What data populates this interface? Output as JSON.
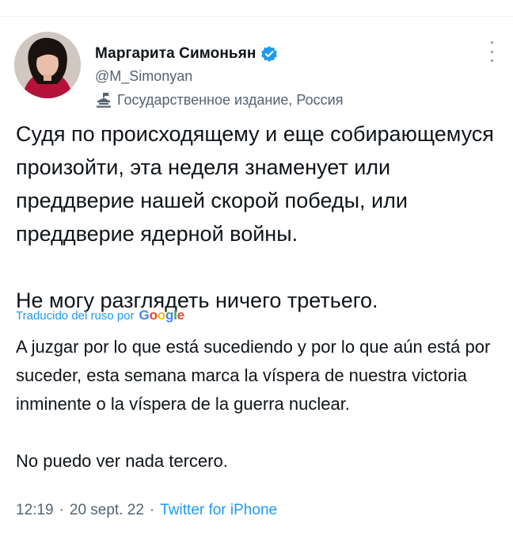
{
  "author": {
    "display_name": "Маргарита Симоньян",
    "handle": "@M_Simonyan",
    "affiliation": "Государственное издание, Россия",
    "verified_icon": "verified-badge-icon",
    "affiliation_icon": "state-media-flag-icon"
  },
  "tweet": {
    "original_paragraphs": [
      "Судя по происходящему и еще собирающемуся произойти, эта неделя знаменует или преддверие нашей скорой победы, или преддверие ядерной войны.",
      "Не могу разглядеть ничего третьего."
    ],
    "translation_label": "Traducido del ruso por",
    "translation_provider": "Google",
    "translated_paragraphs": [
      "A juzgar por lo que está sucediendo y por lo que aún está por suceder, esta semana marca la víspera de nuestra victoria inminente o la víspera de la guerra nuclear.",
      "No puedo ver nada tercero."
    ]
  },
  "meta": {
    "time": "12:19",
    "date": "20 sept. 22",
    "separator": "·",
    "source": "Twitter for iPhone"
  },
  "colors": {
    "link": "#1d9bf0",
    "secondary_text": "#536471",
    "primary_text": "#0f1419"
  }
}
